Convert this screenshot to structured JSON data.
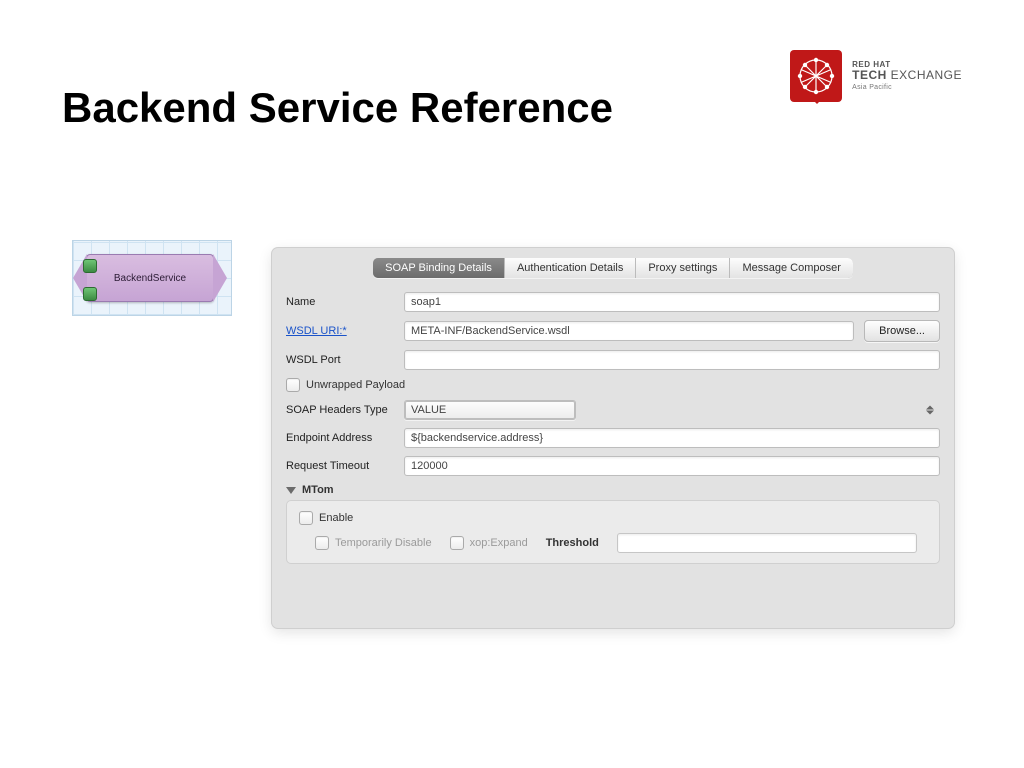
{
  "header": {
    "title": "Backend Service Reference",
    "brand_sub": "RED HAT",
    "brand_main_bold": "TECH",
    "brand_main_rest": " EXCHANGE",
    "brand_region": "Asia Pacific"
  },
  "node": {
    "label": "BackendService"
  },
  "tabs": {
    "t0": "SOAP Binding Details",
    "t1": "Authentication Details",
    "t2": "Proxy settings",
    "t3": "Message Composer"
  },
  "form": {
    "name_label": "Name",
    "name_value": "soap1",
    "wsdl_uri_label": "WSDL URI:*",
    "wsdl_uri_value": "META-INF/BackendService.wsdl",
    "browse_label": "Browse...",
    "wsdl_port_label": "WSDL Port",
    "wsdl_port_value": "",
    "unwrapped_label": "Unwrapped Payload",
    "headers_label": "SOAP Headers Type",
    "headers_value": "VALUE",
    "endpoint_label": "Endpoint Address",
    "endpoint_value": "${backendservice.address}",
    "timeout_label": "Request Timeout",
    "timeout_value": "120000",
    "mtom_label": "MTom",
    "enable_label": "Enable",
    "temp_disable_label": "Temporarily Disable",
    "xop_label": "xop:Expand",
    "threshold_label": "Threshold"
  }
}
